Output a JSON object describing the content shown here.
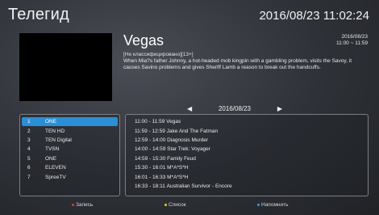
{
  "header": {
    "title": "Телегид",
    "datetime": "2016/08/23 11:02:24"
  },
  "program": {
    "title": "Vegas",
    "date": "2016/08/23",
    "time": "11:00 ~ 11:59",
    "rating": "[Не классифицировано][13+]",
    "description": "When Mia?s father Johnny, a hot-headed mob kingpin with a gambling problem, visits the Savoy, it causes Savino problems and gives Sheriff Lamb a reason to break out the handcuffs."
  },
  "date_nav": {
    "date": "2016/08/23",
    "prev": "◀",
    "next": "▶"
  },
  "channels": [
    {
      "num": "1",
      "name": "ONE"
    },
    {
      "num": "2",
      "name": "TEN HD"
    },
    {
      "num": "3",
      "name": "TEN Digital"
    },
    {
      "num": "4",
      "name": "TVSN"
    },
    {
      "num": "5",
      "name": "ONE"
    },
    {
      "num": "6",
      "name": "ELEVEN"
    },
    {
      "num": "7",
      "name": "SpreeTV"
    }
  ],
  "selected_channel_index": 0,
  "schedule": [
    {
      "time": "11:00 - 11:59",
      "title": "Vegas"
    },
    {
      "time": "11:59 - 12:59",
      "title": "Jake And The Fatman"
    },
    {
      "time": "12:59 - 14:00",
      "title": "Diagnosis Murder"
    },
    {
      "time": "14:00 - 14:59",
      "title": "Star Trek: Voyager"
    },
    {
      "time": "14:59 - 15:30",
      "title": "Family Feud"
    },
    {
      "time": "15:30 - 16:01",
      "title": "M*A*S*H"
    },
    {
      "time": "16:01 - 16:33",
      "title": "M*A*S*H"
    },
    {
      "time": "16:33 - 18:11",
      "title": "Australian Survivor - Encore"
    }
  ],
  "footer": {
    "record": {
      "label": "Запись",
      "color": "#e53935"
    },
    "list": {
      "label": "Список",
      "color": "#e6d31f"
    },
    "remind": {
      "label": "Напомнить",
      "color": "#2aa3e6"
    }
  },
  "colors": {
    "selection": "#2a8fd6",
    "panel_border": "#7b7e84"
  }
}
